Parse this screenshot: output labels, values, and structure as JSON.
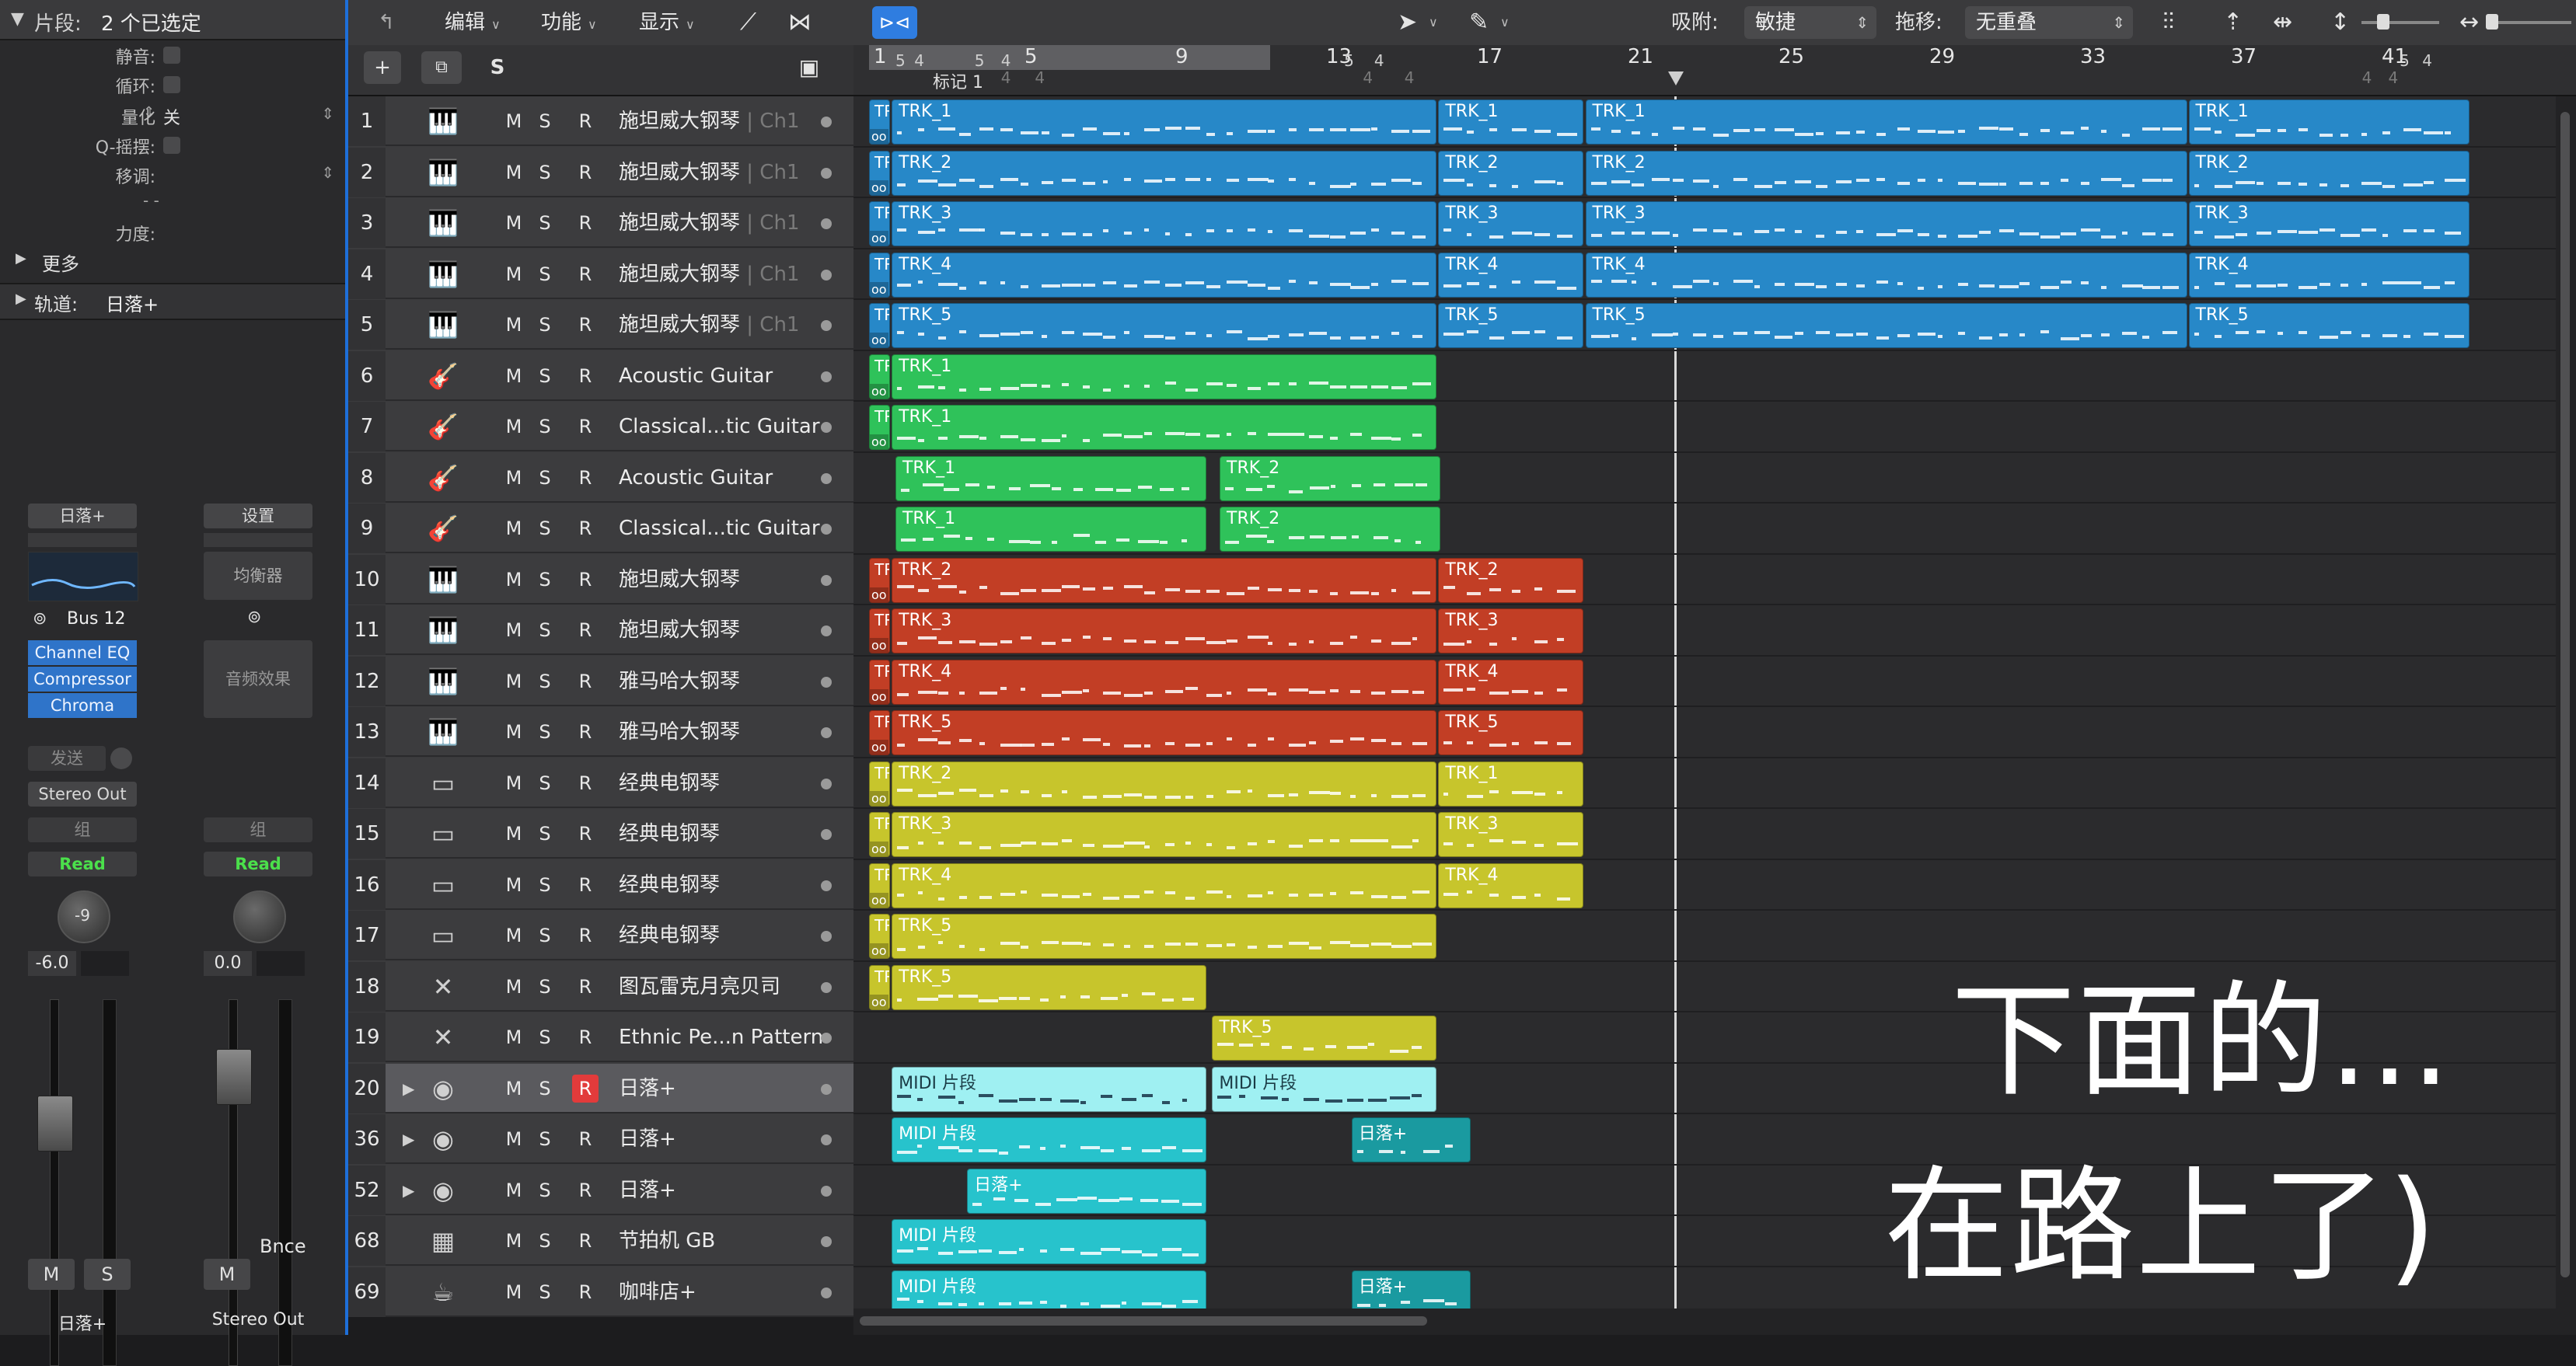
{
  "inspector": {
    "region_label": "片段:",
    "region_value": "2 个已选定",
    "mute_label": "静音:",
    "loop_label": "循环:",
    "quantize_label": "量化",
    "quantize_value": "关",
    "qswing_label": "Q-摇摆:",
    "transpose_label": "移调:",
    "transpose_value": "- -",
    "velocity_label": "力度:",
    "more_label": "更多",
    "track_label": "轨道:",
    "track_value": "日落+"
  },
  "strip1": {
    "name": "日落+",
    "send": "Bus 12",
    "plugins": [
      "Channel EQ",
      "Compressor",
      "Chroma"
    ],
    "sends_label": "发送",
    "output": "Stereo Out",
    "group": "组",
    "automation": "Read",
    "pan": "-9",
    "volume": "-6.0",
    "mute": "M",
    "solo": "S",
    "footer": "日落+"
  },
  "strip2": {
    "settings": "设置",
    "eq": "均衡器",
    "fx": "音频效果",
    "group": "组",
    "automation": "Read",
    "volume": "0.0",
    "mute": "M",
    "bounce": "Bnce",
    "footer": "Stereo Out"
  },
  "track_toolbar": {
    "edit": "编辑",
    "functions": "功能",
    "view": "显示",
    "add_icon": "+",
    "solo_icon": "S"
  },
  "main_toolbar": {
    "snap_label": "吸附:",
    "snap_value": "敏捷",
    "drag_label": "拖移:",
    "drag_value": "无重叠"
  },
  "ruler": {
    "bars": [
      "1",
      "5",
      "9",
      "13",
      "17",
      "21",
      "25",
      "29",
      "33",
      "37",
      "41"
    ],
    "marker": "标记 1",
    "sub_4_label": "4",
    "sub_5_label": "5"
  },
  "tracks": [
    {
      "num": "1",
      "icon": "piano-icon",
      "glyph": "🎹",
      "name": "施坦威大钢琴",
      "ch": "| Ch1"
    },
    {
      "num": "2",
      "icon": "piano-icon",
      "glyph": "🎹",
      "name": "施坦威大钢琴",
      "ch": "| Ch1"
    },
    {
      "num": "3",
      "icon": "piano-icon",
      "glyph": "🎹",
      "name": "施坦威大钢琴",
      "ch": "| Ch1"
    },
    {
      "num": "4",
      "icon": "piano-icon",
      "glyph": "🎹",
      "name": "施坦威大钢琴",
      "ch": "| Ch1"
    },
    {
      "num": "5",
      "icon": "piano-icon",
      "glyph": "🎹",
      "name": "施坦威大钢琴",
      "ch": "| Ch1"
    },
    {
      "num": "6",
      "icon": "guitar-icon",
      "glyph": "🎸",
      "name": "Acoustic Guitar",
      "ch": ""
    },
    {
      "num": "7",
      "icon": "guitar-icon",
      "glyph": "🎸",
      "name": "Classical...tic Guitar",
      "ch": ""
    },
    {
      "num": "8",
      "icon": "guitar-icon",
      "glyph": "🎸",
      "name": "Acoustic Guitar",
      "ch": ""
    },
    {
      "num": "9",
      "icon": "guitar-icon",
      "glyph": "🎸",
      "name": "Classical...tic Guitar",
      "ch": ""
    },
    {
      "num": "10",
      "icon": "piano-icon",
      "glyph": "🎹",
      "name": "施坦威大钢琴",
      "ch": ""
    },
    {
      "num": "11",
      "icon": "piano-icon",
      "glyph": "🎹",
      "name": "施坦威大钢琴",
      "ch": ""
    },
    {
      "num": "12",
      "icon": "piano-icon",
      "glyph": "🎹",
      "name": "雅马哈大钢琴",
      "ch": ""
    },
    {
      "num": "13",
      "icon": "piano-icon",
      "glyph": "🎹",
      "name": "雅马哈大钢琴",
      "ch": ""
    },
    {
      "num": "14",
      "icon": "electric-piano-icon",
      "glyph": "▭",
      "name": "经典电钢琴",
      "ch": ""
    },
    {
      "num": "15",
      "icon": "electric-piano-icon",
      "glyph": "▭",
      "name": "经典电钢琴",
      "ch": ""
    },
    {
      "num": "16",
      "icon": "electric-piano-icon",
      "glyph": "▭",
      "name": "经典电钢琴",
      "ch": ""
    },
    {
      "num": "17",
      "icon": "electric-piano-icon",
      "glyph": "▭",
      "name": "经典电钢琴",
      "ch": ""
    },
    {
      "num": "18",
      "icon": "percussion-icon",
      "glyph": "✕",
      "name": "图瓦雷克月亮贝司",
      "ch": ""
    },
    {
      "num": "19",
      "icon": "percussion-icon",
      "glyph": "✕",
      "name": "Ethnic Pe...n Pattern",
      "ch": ""
    },
    {
      "num": "20",
      "icon": "stack-icon",
      "glyph": "◉",
      "name": "日落+",
      "ch": "",
      "disc": true,
      "rec": true,
      "sel": true
    },
    {
      "num": "36",
      "icon": "stack-icon",
      "glyph": "◉",
      "name": "日落+",
      "ch": "",
      "disc": true
    },
    {
      "num": "52",
      "icon": "stack-icon",
      "glyph": "◉",
      "name": "日落+",
      "ch": "",
      "disc": true
    },
    {
      "num": "68",
      "icon": "drum-machine-icon",
      "glyph": "▦",
      "name": "节拍机 GB",
      "ch": ""
    },
    {
      "num": "69",
      "icon": "cafe-icon",
      "glyph": "☕",
      "name": "咖啡店+",
      "ch": ""
    }
  ],
  "regions": [
    {
      "row": 0,
      "start": 1,
      "end": 1.6,
      "label": "TR",
      "tr": true,
      "color": "r-blue"
    },
    {
      "row": 0,
      "start": 1.6,
      "end": 16.1,
      "label": "TRK_1",
      "color": "r-blue"
    },
    {
      "row": 0,
      "start": 16.1,
      "end": 20,
      "label": "TRK_1",
      "color": "r-blue"
    },
    {
      "row": 0,
      "start": 20,
      "end": 36,
      "label": "TRK_1",
      "color": "r-blue"
    },
    {
      "row": 0,
      "start": 36,
      "end": 43.5,
      "label": "TRK_1",
      "color": "r-blue"
    },
    {
      "row": 1,
      "start": 1,
      "end": 1.6,
      "label": "TR",
      "tr": true,
      "color": "r-blue"
    },
    {
      "row": 1,
      "start": 1.6,
      "end": 16.1,
      "label": "TRK_2",
      "color": "r-blue"
    },
    {
      "row": 1,
      "start": 16.1,
      "end": 20,
      "label": "TRK_2",
      "color": "r-blue"
    },
    {
      "row": 1,
      "start": 20,
      "end": 36,
      "label": "TRK_2",
      "color": "r-blue"
    },
    {
      "row": 1,
      "start": 36,
      "end": 43.5,
      "label": "TRK_2",
      "color": "r-blue"
    },
    {
      "row": 2,
      "start": 1,
      "end": 1.6,
      "label": "TR",
      "tr": true,
      "color": "r-blue"
    },
    {
      "row": 2,
      "start": 1.6,
      "end": 16.1,
      "label": "TRK_3",
      "color": "r-blue"
    },
    {
      "row": 2,
      "start": 16.1,
      "end": 20,
      "label": "TRK_3",
      "color": "r-blue"
    },
    {
      "row": 2,
      "start": 20,
      "end": 36,
      "label": "TRK_3",
      "color": "r-blue"
    },
    {
      "row": 2,
      "start": 36,
      "end": 43.5,
      "label": "TRK_3",
      "color": "r-blue"
    },
    {
      "row": 3,
      "start": 1,
      "end": 1.6,
      "label": "TR",
      "tr": true,
      "color": "r-blue"
    },
    {
      "row": 3,
      "start": 1.6,
      "end": 16.1,
      "label": "TRK_4",
      "color": "r-blue"
    },
    {
      "row": 3,
      "start": 16.1,
      "end": 20,
      "label": "TRK_4",
      "color": "r-blue"
    },
    {
      "row": 3,
      "start": 20,
      "end": 36,
      "label": "TRK_4",
      "color": "r-blue"
    },
    {
      "row": 3,
      "start": 36,
      "end": 43.5,
      "label": "TRK_4",
      "color": "r-blue"
    },
    {
      "row": 4,
      "start": 1,
      "end": 1.6,
      "label": "TR",
      "tr": true,
      "color": "r-blue"
    },
    {
      "row": 4,
      "start": 1.6,
      "end": 16.1,
      "label": "TRK_5",
      "color": "r-blue"
    },
    {
      "row": 4,
      "start": 16.1,
      "end": 20,
      "label": "TRK_5",
      "color": "r-blue"
    },
    {
      "row": 4,
      "start": 20,
      "end": 36,
      "label": "TRK_5",
      "color": "r-blue"
    },
    {
      "row": 4,
      "start": 36,
      "end": 43.5,
      "label": "TRK_5",
      "color": "r-blue"
    },
    {
      "row": 5,
      "start": 1,
      "end": 1.6,
      "label": "TR",
      "tr": true,
      "color": "r-green"
    },
    {
      "row": 5,
      "start": 1.6,
      "end": 16.1,
      "label": "TRK_1",
      "color": "r-green"
    },
    {
      "row": 6,
      "start": 1,
      "end": 1.6,
      "label": "TR",
      "tr": true,
      "color": "r-green"
    },
    {
      "row": 6,
      "start": 1.6,
      "end": 16.1,
      "label": "TRK_1",
      "color": "r-green"
    },
    {
      "row": 7,
      "start": 1.7,
      "end": 10,
      "label": "TRK_1",
      "color": "r-green"
    },
    {
      "row": 7,
      "start": 10.3,
      "end": 16.2,
      "label": "TRK_2",
      "color": "r-green"
    },
    {
      "row": 8,
      "start": 1.7,
      "end": 10,
      "label": "TRK_1",
      "color": "r-green"
    },
    {
      "row": 8,
      "start": 10.3,
      "end": 16.2,
      "label": "TRK_2",
      "color": "r-green"
    },
    {
      "row": 9,
      "start": 1,
      "end": 1.6,
      "label": "TR",
      "tr": true,
      "color": "r-red"
    },
    {
      "row": 9,
      "start": 1.6,
      "end": 16.1,
      "label": "TRK_2",
      "color": "r-red"
    },
    {
      "row": 9,
      "start": 16.1,
      "end": 20,
      "label": "TRK_2",
      "color": "r-red"
    },
    {
      "row": 10,
      "start": 1,
      "end": 1.6,
      "label": "TR",
      "tr": true,
      "color": "r-red"
    },
    {
      "row": 10,
      "start": 1.6,
      "end": 16.1,
      "label": "TRK_3",
      "color": "r-red"
    },
    {
      "row": 10,
      "start": 16.1,
      "end": 20,
      "label": "TRK_3",
      "color": "r-red"
    },
    {
      "row": 11,
      "start": 1,
      "end": 1.6,
      "label": "TR",
      "tr": true,
      "color": "r-red"
    },
    {
      "row": 11,
      "start": 1.6,
      "end": 16.1,
      "label": "TRK_4",
      "color": "r-red"
    },
    {
      "row": 11,
      "start": 16.1,
      "end": 20,
      "label": "TRK_4",
      "color": "r-red"
    },
    {
      "row": 12,
      "start": 1,
      "end": 1.6,
      "label": "TR",
      "tr": true,
      "color": "r-red"
    },
    {
      "row": 12,
      "start": 1.6,
      "end": 16.1,
      "label": "TRK_5",
      "color": "r-red"
    },
    {
      "row": 12,
      "start": 16.1,
      "end": 20,
      "label": "TRK_5",
      "color": "r-red"
    },
    {
      "row": 13,
      "start": 1,
      "end": 1.6,
      "label": "TR",
      "tr": true,
      "color": "r-yellow"
    },
    {
      "row": 13,
      "start": 1.6,
      "end": 16.1,
      "label": "TRK_2",
      "color": "r-yellow"
    },
    {
      "row": 13,
      "start": 16.1,
      "end": 20,
      "label": "TRK_1",
      "color": "r-yellow"
    },
    {
      "row": 14,
      "start": 1,
      "end": 1.6,
      "label": "TR",
      "tr": true,
      "color": "r-yellow"
    },
    {
      "row": 14,
      "start": 1.6,
      "end": 16.1,
      "label": "TRK_3",
      "color": "r-yellow"
    },
    {
      "row": 14,
      "start": 16.1,
      "end": 20,
      "label": "TRK_3",
      "color": "r-yellow"
    },
    {
      "row": 15,
      "start": 1,
      "end": 1.6,
      "label": "TR",
      "tr": true,
      "color": "r-yellow"
    },
    {
      "row": 15,
      "start": 1.6,
      "end": 16.1,
      "label": "TRK_4",
      "color": "r-yellow"
    },
    {
      "row": 15,
      "start": 16.1,
      "end": 20,
      "label": "TRK_4",
      "color": "r-yellow"
    },
    {
      "row": 16,
      "start": 1,
      "end": 1.6,
      "label": "TR",
      "tr": true,
      "color": "r-yellow"
    },
    {
      "row": 16,
      "start": 1.6,
      "end": 16.1,
      "label": "TRK_5",
      "color": "r-yellow"
    },
    {
      "row": 17,
      "start": 1,
      "end": 1.6,
      "label": "TR",
      "tr": true,
      "color": "r-yellow"
    },
    {
      "row": 17,
      "start": 1.6,
      "end": 10,
      "label": "TRK_5",
      "color": "r-yellow"
    },
    {
      "row": 18,
      "start": 10.1,
      "end": 16.1,
      "label": "TRK_5",
      "color": "r-yellow"
    },
    {
      "row": 19,
      "start": 1.6,
      "end": 10,
      "label": "MIDI 片段",
      "color": "r-cyan"
    },
    {
      "row": 19,
      "start": 10.1,
      "end": 16.1,
      "label": "MIDI 片段",
      "color": "r-cyan"
    },
    {
      "row": 20,
      "start": 1.6,
      "end": 10,
      "label": "MIDI 片段",
      "color": "r-teal"
    },
    {
      "row": 20,
      "start": 13.8,
      "end": 17,
      "label": "日落+",
      "color": "r-teal2"
    },
    {
      "row": 21,
      "start": 3.6,
      "end": 10,
      "label": "日落+",
      "color": "r-teal"
    },
    {
      "row": 22,
      "start": 1.6,
      "end": 10,
      "label": "MIDI 片段",
      "color": "r-teal"
    },
    {
      "row": 23,
      "start": 1.6,
      "end": 10,
      "label": "MIDI 片段",
      "color": "r-teal"
    },
    {
      "row": 23,
      "start": 13.8,
      "end": 17,
      "label": "日落+",
      "color": "r-teal2"
    }
  ],
  "overlay": {
    "line1": "下面的...",
    "line2": "在路上了)"
  }
}
